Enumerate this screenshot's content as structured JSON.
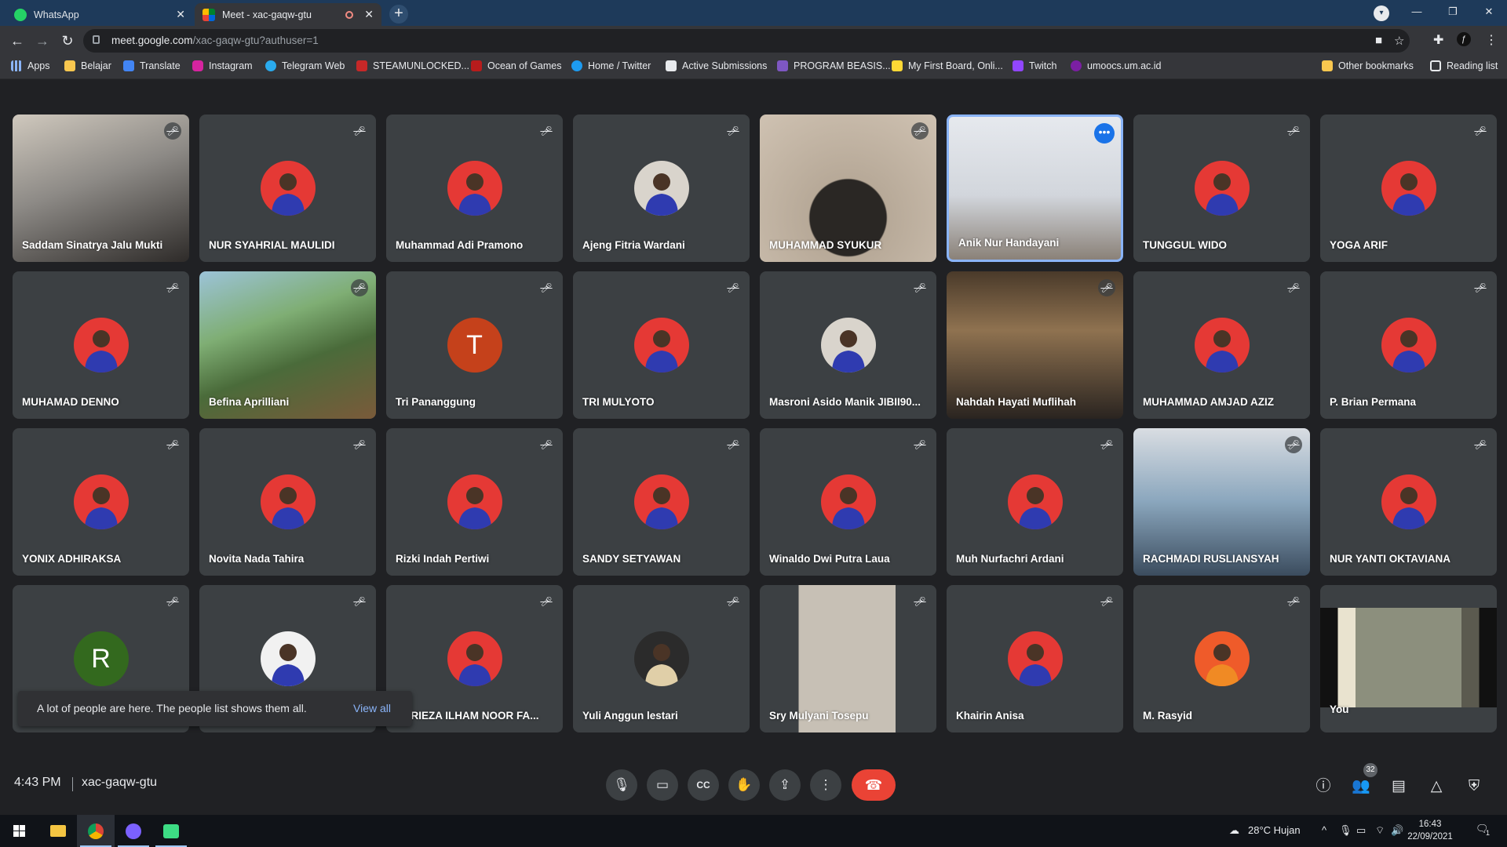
{
  "browser": {
    "tabs": [
      {
        "label": "WhatsApp"
      },
      {
        "label": "Meet - xac-gaqw-gtu"
      }
    ],
    "new_tab": "+",
    "url_host": "meet.google.com",
    "url_path": "/xac-gaqw-gtu?authuser=1",
    "bookmarks": [
      "Apps",
      "Belajar",
      "Translate",
      "Instagram",
      "Telegram Web",
      "STEAMUNLOCKED...",
      "Ocean of Games",
      "Home / Twitter",
      "Active Submissions",
      "PROGRAM BEASIS...",
      "My First Board, Onli...",
      "Twitch",
      "umoocs.um.ac.id"
    ],
    "other_bookmarks": "Other bookmarks",
    "reading_list": "Reading list"
  },
  "participants": [
    {
      "name": "Saddam Sinatrya Jalu Mukti"
    },
    {
      "name": "NUR SYAHRIAL MAULIDI"
    },
    {
      "name": "Muhammad Adi Pramono"
    },
    {
      "name": "Ajeng Fitria Wardani"
    },
    {
      "name": "MUHAMMAD SYUKUR"
    },
    {
      "name": "Anik Nur Handayani"
    },
    {
      "name": "TUNGGUL WIDO"
    },
    {
      "name": "YOGA ARIF"
    },
    {
      "name": "MUHAMAD DENNO"
    },
    {
      "name": "Befina Aprilliani"
    },
    {
      "name": "Tri Pananggung",
      "letter": "T"
    },
    {
      "name": "TRI MULYOTO"
    },
    {
      "name": "Masroni Asido Manik JIBII90..."
    },
    {
      "name": "Nahdah Hayati Muflihah"
    },
    {
      "name": "MUHAMMAD AMJAD AZIZ"
    },
    {
      "name": "P. Brian Permana"
    },
    {
      "name": "YONIX ADHIRAKSA"
    },
    {
      "name": "Novita Nada Tahira"
    },
    {
      "name": "Rizki Indah Pertiwi"
    },
    {
      "name": "SANDY SETYAWAN"
    },
    {
      "name": "Winaldo Dwi Putra Laua"
    },
    {
      "name": "Muh Nurfachri Ardani"
    },
    {
      "name": "RACHMADI RUSLIANSYAH"
    },
    {
      "name": "NUR YANTI OKTAVIANA"
    },
    {
      "name": "",
      "letter": "R"
    },
    {
      "name": ""
    },
    {
      "name": "AHRIEZA ILHAM NOOR FA..."
    },
    {
      "name": "Yuli Anggun lestari"
    },
    {
      "name": "Sry Mulyani Tosepu"
    },
    {
      "name": "Khairin Anisa"
    },
    {
      "name": "M. Rasyid"
    },
    {
      "name": "You"
    }
  ],
  "toast": {
    "message": "A lot of people are here. The people list shows them all.",
    "action": "View all"
  },
  "meeting": {
    "time": "4:43 PM",
    "code": "xac-gaqw-gtu",
    "people_count": "32"
  },
  "taskbar": {
    "weather": "28°C  Hujan",
    "time": "16:43",
    "date": "22/09/2021",
    "notif": "1"
  }
}
